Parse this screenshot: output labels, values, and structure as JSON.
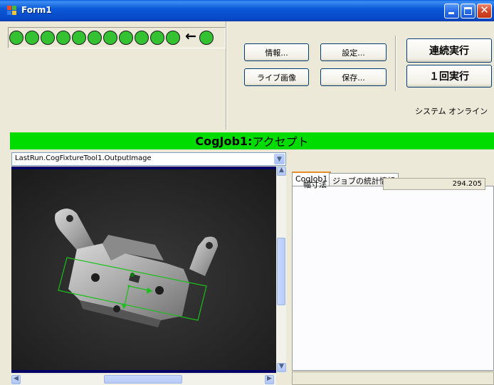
{
  "window": {
    "title": "Form1"
  },
  "toolbar": {
    "info_label": "情報...",
    "settings_label": "設定...",
    "live_image_label": "ライブ画像",
    "save_label": "保存...",
    "continuous_run_label": "連続実行",
    "single_run_label": "１回実行",
    "system_status": "システム オンライン"
  },
  "led_history": {
    "count": 11,
    "color": "#34c232",
    "arrow": "←"
  },
  "result_bar": {
    "job_name": "CogJob1:",
    "status": " アクセプト",
    "color": "#00dc00"
  },
  "image_panel": {
    "image_selector": "LastRun.CogFixtureTool1.OutputImage"
  },
  "results_panel": {
    "tabs": [
      {
        "label": "CogJob1",
        "active": true
      },
      {
        "label": "ジョブの統計情報",
        "active": false
      }
    ],
    "measurement_label": "幅寸法",
    "measurement_value": "294.205"
  }
}
